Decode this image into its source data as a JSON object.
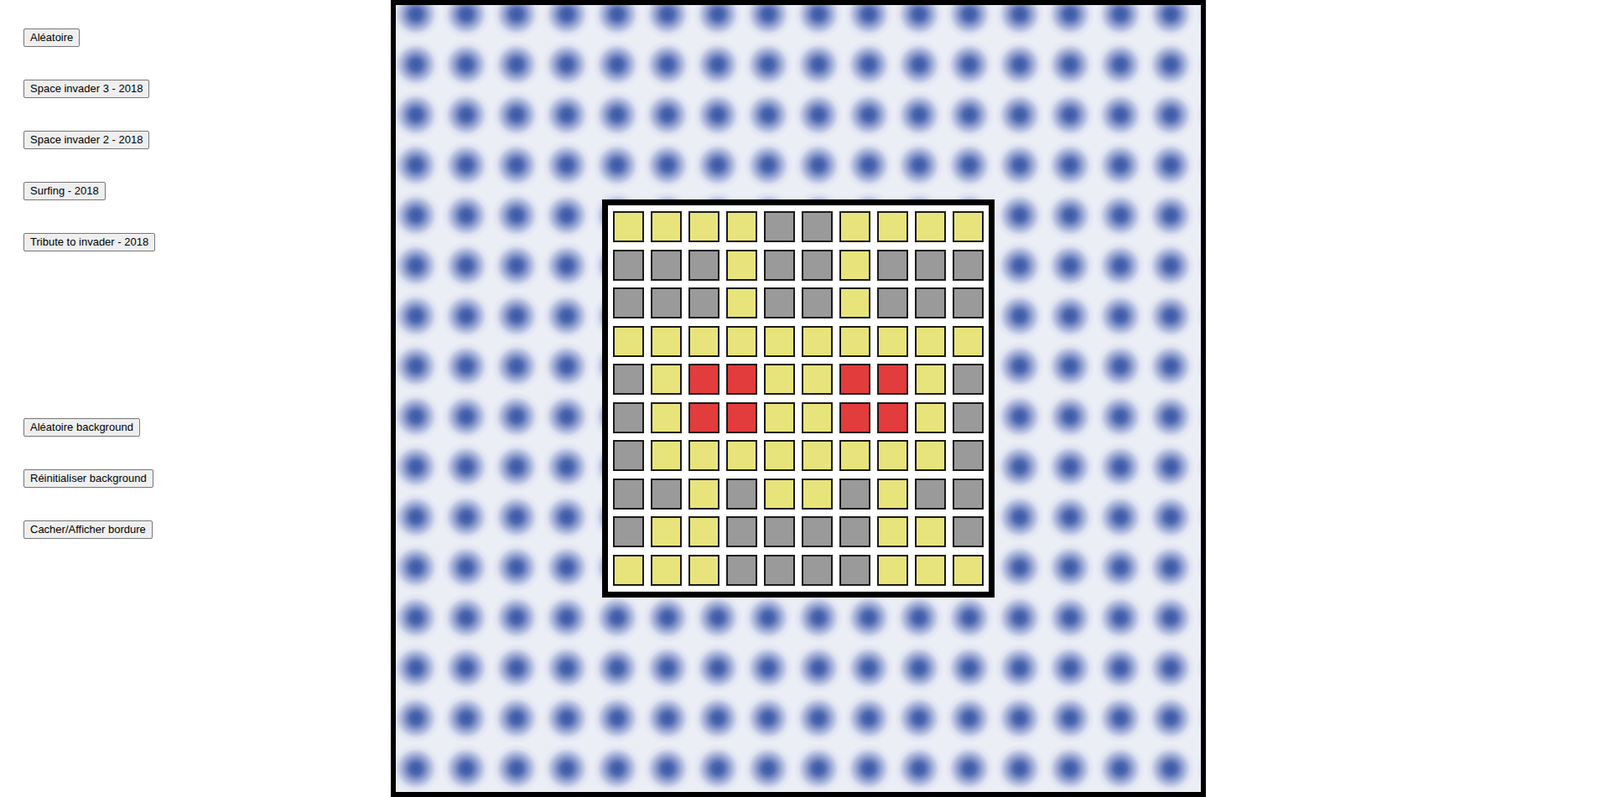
{
  "controls": {
    "patterns": [
      {
        "label": "Aléatoire"
      },
      {
        "label": "Space invader 3 - 2018"
      },
      {
        "label": "Space invader 2 - 2018"
      },
      {
        "label": "Surfing - 2018"
      },
      {
        "label": "Tribute to invader - 2018"
      }
    ],
    "background": [
      {
        "label": "Aléatoire background"
      },
      {
        "label": "Réinitialiser background"
      },
      {
        "label": "Cacher/Afficher bordure"
      }
    ]
  },
  "board": {
    "rows": [
      [
        "#e8e47c",
        "#e8e47c",
        "#e8e47c",
        "#e8e47c",
        "#9a9a9a",
        "#9a9a9a",
        "#e8e47c",
        "#e8e47c",
        "#e8e47c",
        "#e8e47c"
      ],
      [
        "#9a9a9a",
        "#9a9a9a",
        "#9a9a9a",
        "#e8e47c",
        "#9a9a9a",
        "#9a9a9a",
        "#e8e47c",
        "#9a9a9a",
        "#9a9a9a",
        "#9a9a9a"
      ],
      [
        "#9a9a9a",
        "#9a9a9a",
        "#9a9a9a",
        "#e8e47c",
        "#9a9a9a",
        "#9a9a9a",
        "#e8e47c",
        "#9a9a9a",
        "#9a9a9a",
        "#9a9a9a"
      ],
      [
        "#e8e47c",
        "#e8e47c",
        "#e8e47c",
        "#e8e47c",
        "#e8e47c",
        "#e8e47c",
        "#e8e47c",
        "#e8e47c",
        "#e8e47c",
        "#e8e47c"
      ],
      [
        "#9a9a9a",
        "#e8e47c",
        "#e23c3c",
        "#e23c3c",
        "#e8e47c",
        "#e8e47c",
        "#e23c3c",
        "#e23c3c",
        "#e8e47c",
        "#9a9a9a"
      ],
      [
        "#9a9a9a",
        "#e8e47c",
        "#e23c3c",
        "#e23c3c",
        "#e8e47c",
        "#e8e47c",
        "#e23c3c",
        "#e23c3c",
        "#e8e47c",
        "#9a9a9a"
      ],
      [
        "#9a9a9a",
        "#e8e47c",
        "#e8e47c",
        "#e8e47c",
        "#e8e47c",
        "#e8e47c",
        "#e8e47c",
        "#e8e47c",
        "#e8e47c",
        "#9a9a9a"
      ],
      [
        "#9a9a9a",
        "#9a9a9a",
        "#e8e47c",
        "#9a9a9a",
        "#e8e47c",
        "#e8e47c",
        "#9a9a9a",
        "#e8e47c",
        "#9a9a9a",
        "#9a9a9a"
      ],
      [
        "#9a9a9a",
        "#e8e47c",
        "#e8e47c",
        "#9a9a9a",
        "#9a9a9a",
        "#9a9a9a",
        "#9a9a9a",
        "#e8e47c",
        "#e8e47c",
        "#9a9a9a"
      ],
      [
        "#e8e47c",
        "#e8e47c",
        "#e8e47c",
        "#9a9a9a",
        "#9a9a9a",
        "#9a9a9a",
        "#9a9a9a",
        "#e8e47c",
        "#e8e47c",
        "#e8e47c"
      ]
    ]
  }
}
